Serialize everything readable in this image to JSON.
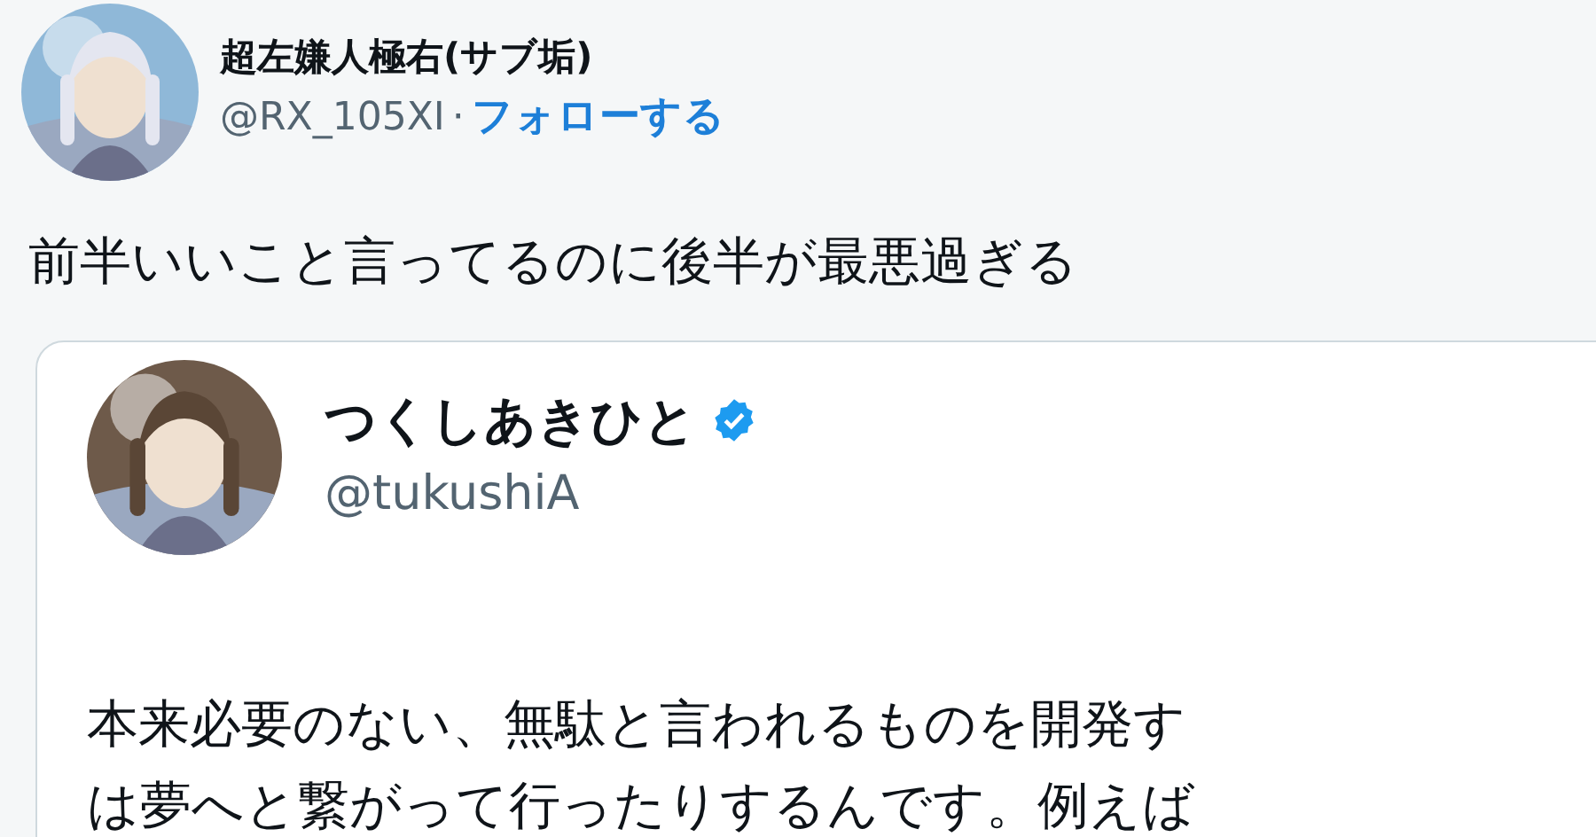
{
  "tweet": {
    "author": {
      "name": "超左嫌人極右(サブ垢)",
      "handle": "@RX_105XI",
      "separator": "·",
      "follow": "フォローする"
    },
    "text": "前半いいこと言ってるのに後半が最悪過ぎる",
    "quoted": {
      "author": {
        "name": "つくしあきひと",
        "verified": true,
        "handle": "@tukushiA"
      },
      "lines": [
        "本来必要のない、無駄と言われるものを開発す",
        "は夢へと繋がって行ったりするんです。例えば"
      ]
    }
  }
}
